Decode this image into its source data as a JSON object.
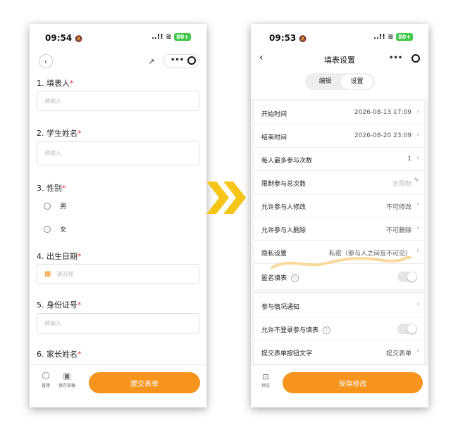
{
  "left": {
    "status": {
      "time": "09:54",
      "signal": "..!!",
      "battery": "80+"
    },
    "questions": [
      {
        "number": "1.",
        "label": "填表人",
        "placeholder": "请输入"
      },
      {
        "number": "2.",
        "label": "学生姓名",
        "placeholder": "请输入"
      },
      {
        "number": "3.",
        "label": "性别",
        "options": [
          "男",
          "女"
        ]
      },
      {
        "number": "4.",
        "label": "出生日期",
        "placeholder": "请选择"
      },
      {
        "number": "5.",
        "label": "身份证号",
        "placeholder": "请输入"
      },
      {
        "number": "6.",
        "label": "家长姓名"
      }
    ],
    "required_mark": "*",
    "bottom": {
      "manage": "管理",
      "save_draft": "保存草稿",
      "submit": "提交表单"
    }
  },
  "right": {
    "status": {
      "time": "09:53",
      "signal": "..!!",
      "battery": "80+"
    },
    "title": "填表设置",
    "tabs": [
      "编辑",
      "设置"
    ],
    "rows1": [
      {
        "label": "开始时间",
        "value": "2026-08-13 17:09"
      },
      {
        "label": "结束时间",
        "value": "2026-08-20 23:09"
      },
      {
        "label": "每人最多参与次数",
        "value": "1"
      },
      {
        "label": "限制参与总次数",
        "value": "无限制"
      },
      {
        "label": "允许参与人修改",
        "value": "不可修改"
      },
      {
        "label": "允许参与人删除",
        "value": "不可删除"
      },
      {
        "label": "隐私设置",
        "value": "私密（参与人之间互不可见）"
      },
      {
        "label": "匿名填表"
      }
    ],
    "rows2": [
      {
        "label": "参与情况通知"
      },
      {
        "label": "允许不登录参与填表"
      },
      {
        "label": "提交表单按钮文字",
        "value": "提交表单"
      }
    ],
    "help_mark": "?",
    "bottom": {
      "preview": "预览",
      "save": "保存修改"
    }
  },
  "colors": {
    "accent": "#f7941d",
    "arrow": "#f5c518",
    "required": "#e33333",
    "battery": "#3fc84a"
  }
}
